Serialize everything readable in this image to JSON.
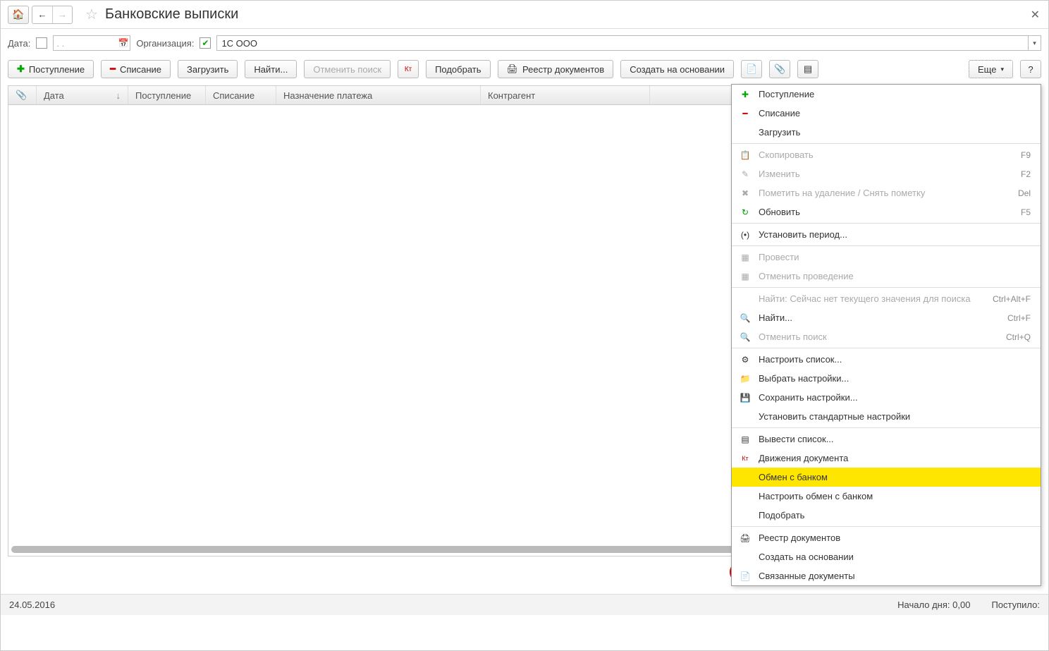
{
  "title": "Банковские выписки",
  "filter": {
    "date_label": "Дата:",
    "date_placeholder": ". .",
    "org_label": "Организация:",
    "org_value": "1С ООО"
  },
  "toolbar": {
    "postuplenie": "Поступление",
    "spisanie": "Списание",
    "zagruzit": "Загрузить",
    "naiti": "Найти...",
    "otmenit_poisk": "Отменить поиск",
    "podobrat": "Подобрать",
    "reestr": "Реестр документов",
    "sozdat": "Создать на основании",
    "eshe": "Еще"
  },
  "columns": {
    "date": "Дата",
    "postuplenie": "Поступление",
    "spisanie": "Списание",
    "naznachenie": "Назначение платежа",
    "kontragent": "Контрагент"
  },
  "status": {
    "date": "24.05.2016",
    "nachalo_label": "Начало дня:",
    "nachalo_val": "0,00",
    "postupilo_label": "Поступило:"
  },
  "menu": {
    "postuplenie": "Поступление",
    "spisanie": "Списание",
    "zagruzit": "Загрузить",
    "skopirovat": "Скопировать",
    "skopirovat_sc": "F9",
    "izmenit": "Изменить",
    "izmenit_sc": "F2",
    "pometit": "Пометить на удаление / Снять пометку",
    "pometit_sc": "Del",
    "obnovit": "Обновить",
    "obnovit_sc": "F5",
    "ustanovit_period": "Установить период...",
    "provesti": "Провести",
    "otmenit_provedenie": "Отменить проведение",
    "naiti_hint": "Найти: Сейчас нет текущего значения для поиска",
    "naiti_hint_sc": "Ctrl+Alt+F",
    "naiti": "Найти...",
    "naiti_sc": "Ctrl+F",
    "otmenit_poisk": "Отменить поиск",
    "otmenit_poisk_sc": "Ctrl+Q",
    "nastroit_spisok": "Настроить список...",
    "vybrat_nastroiki": "Выбрать настройки...",
    "sohranit_nastroiki": "Сохранить настройки...",
    "ustanovit_std": "Установить стандартные настройки",
    "vyvesti_spisok": "Вывести список...",
    "dvizheniya": "Движения документа",
    "obmen": "Обмен с банком",
    "nastroit_obmen": "Настроить обмен с банком",
    "podobrat": "Подобрать",
    "reestr": "Реестр документов",
    "sozdat": "Создать на основании",
    "svyazannye": "Связанные документы"
  }
}
